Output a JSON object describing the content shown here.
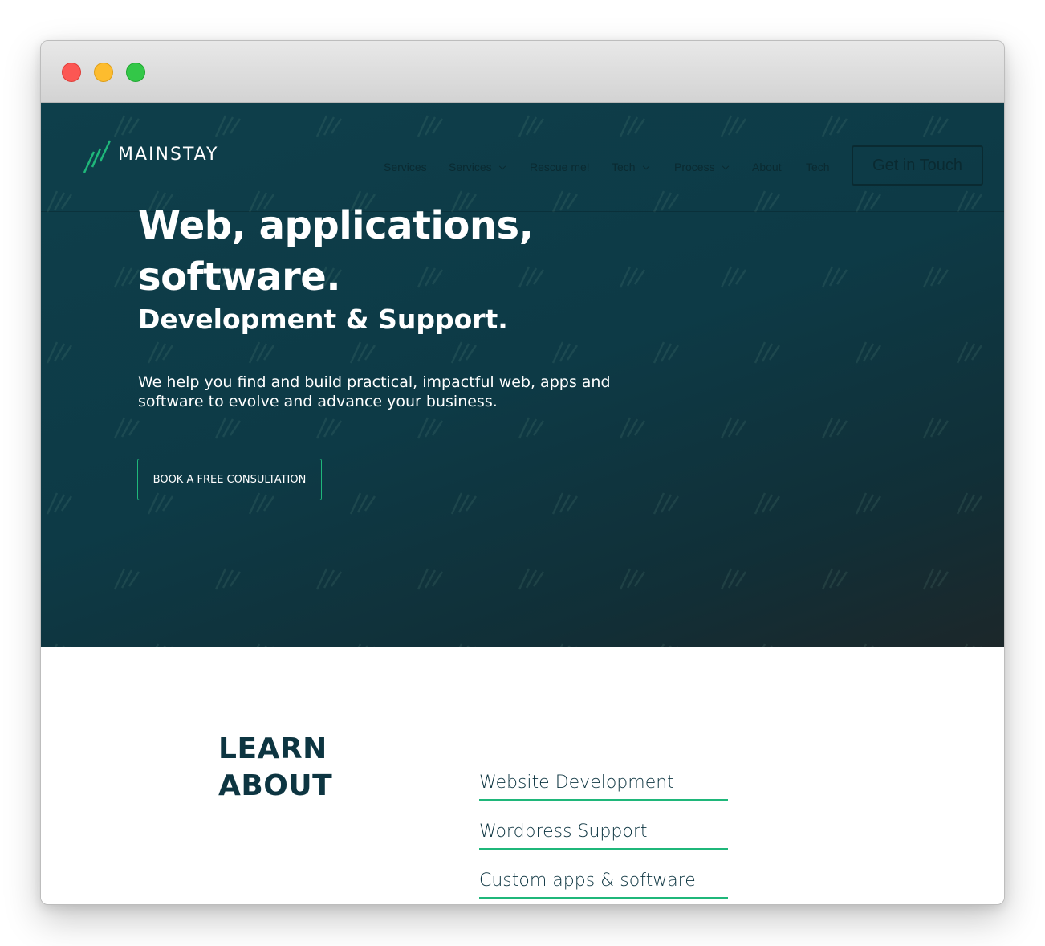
{
  "window": {
    "controls": [
      "close",
      "minimize",
      "zoom"
    ]
  },
  "header": {
    "logo_text": "MAINSTAY",
    "nav": [
      {
        "label": "Services",
        "dropdown": false
      },
      {
        "label": "Services",
        "dropdown": true
      },
      {
        "label": "Rescue me!",
        "dropdown": false
      },
      {
        "label": "Tech",
        "dropdown": true
      },
      {
        "label": "Process",
        "dropdown": true
      },
      {
        "label": "About",
        "dropdown": false
      },
      {
        "label": "Tech",
        "dropdown": false
      }
    ],
    "cta_label": "Get in Touch"
  },
  "hero": {
    "title": "Web, applications, software.",
    "subtitle": "Development & Support.",
    "description": "We help you find and build practical, impactful web, apps and software to evolve and advance your business.",
    "button_label": "BOOK A FREE CONSULTATION"
  },
  "learn": {
    "title": "LEARN ABOUT",
    "links": [
      "Website Development",
      "Wordpress Support",
      "Custom apps & software"
    ]
  },
  "colors": {
    "hero_bg": "#0e3f4b",
    "accent": "#1fb77a",
    "dark_text": "#0d3541",
    "nav_text": "#0a2a31"
  }
}
